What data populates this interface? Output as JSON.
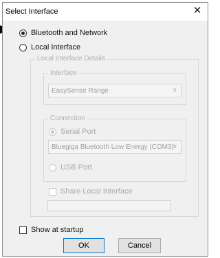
{
  "dialog": {
    "title": "Select Interface",
    "close_glyph": "✕"
  },
  "options": {
    "bluetooth_network": "Bluetooth and Network",
    "local_interface": "Local Interface"
  },
  "local_details": {
    "group_label": "Local Interface Details",
    "interface": {
      "group_label": "Interface",
      "selected": "EasySense Range"
    },
    "connection": {
      "group_label": "Connection",
      "serial_port_label": "Serial Port",
      "serial_port_selected": "Bluegiga Bluetooth Low Energy (COM3)",
      "usb_port_label": "USB Port"
    },
    "share_local_label": "Share Local Interface",
    "share_name_value": ""
  },
  "footer": {
    "show_at_startup_label": "Show at startup",
    "ok_label": "OK",
    "cancel_label": "Cancel"
  },
  "icons": {
    "dropdown": "chevron-down-icon",
    "pointer": "arrow-pointer-icon"
  }
}
